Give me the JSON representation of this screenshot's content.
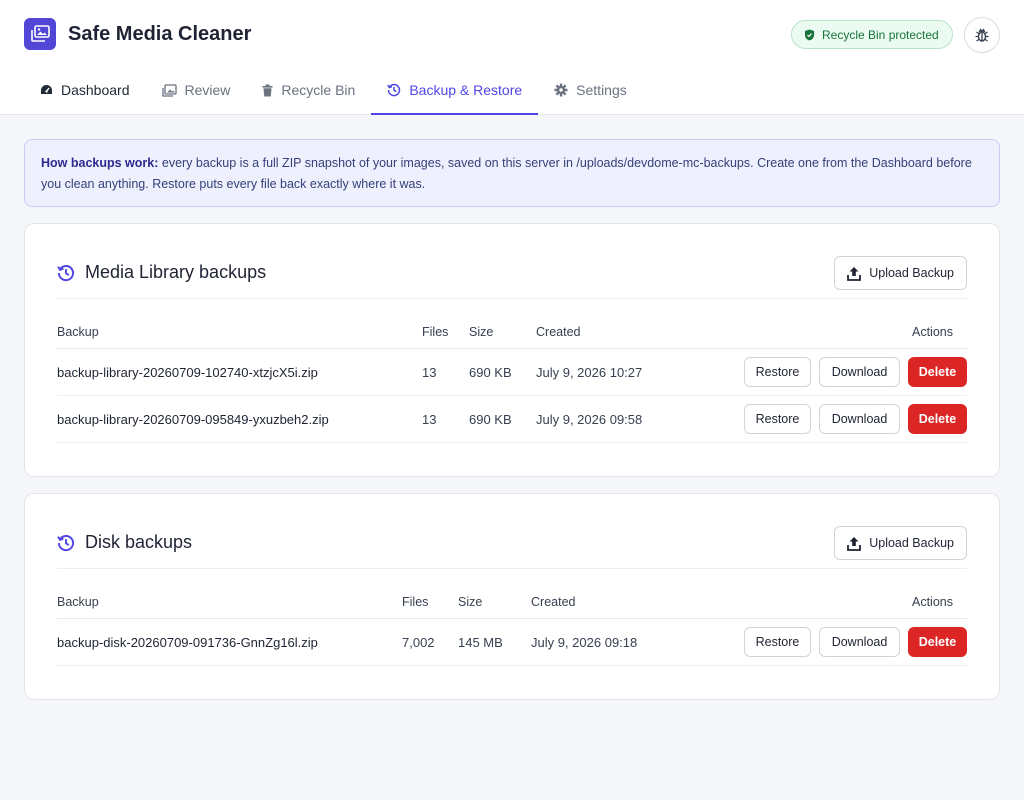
{
  "app": {
    "title": "Safe Media Cleaner"
  },
  "header": {
    "badge_label": "Recycle Bin protected"
  },
  "tabs": [
    {
      "label": "Dashboard",
      "icon": "gauge-icon"
    },
    {
      "label": "Review",
      "icon": "images-icon"
    },
    {
      "label": "Recycle Bin",
      "icon": "trash-icon"
    },
    {
      "label": "Backup & Restore",
      "icon": "history-icon",
      "active": true
    },
    {
      "label": "Settings",
      "icon": "gear-icon"
    }
  ],
  "notice": {
    "bold": "How backups work:",
    "text": " every backup is a full ZIP snapshot of your images, saved on this server in /uploads/devdome-mc-backups. Create one from the Dashboard before you clean anything. Restore puts every file back exactly where it was."
  },
  "library": {
    "title": "Media Library backups",
    "upload_label": "Upload Backup",
    "columns": {
      "backup": "Backup",
      "files": "Files",
      "size": "Size",
      "created": "Created",
      "actions": "Actions"
    },
    "rows": [
      {
        "name": "backup-library-20260709-102740-xtzjcX5i.zip",
        "files": "13",
        "size": "690 KB",
        "created": "July 9, 2026 10:27"
      },
      {
        "name": "backup-library-20260709-095849-yxuzbeh2.zip",
        "files": "13",
        "size": "690 KB",
        "created": "July 9, 2026 09:58"
      }
    ]
  },
  "disk": {
    "title": "Disk backups",
    "upload_label": "Upload Backup",
    "columns": {
      "backup": "Backup",
      "files": "Files",
      "size": "Size",
      "created": "Created",
      "actions": "Actions"
    },
    "rows": [
      {
        "name": "backup-disk-20260709-091736-GnnZg16l.zip",
        "files": "7,002",
        "size": "145 MB",
        "created": "July 9, 2026 09:18"
      }
    ]
  },
  "row_actions": {
    "restore": "Restore",
    "download": "Download",
    "delete": "Delete"
  },
  "colors": {
    "accent": "#4f46e5",
    "danger": "#dc2626",
    "success": "#16743a"
  }
}
